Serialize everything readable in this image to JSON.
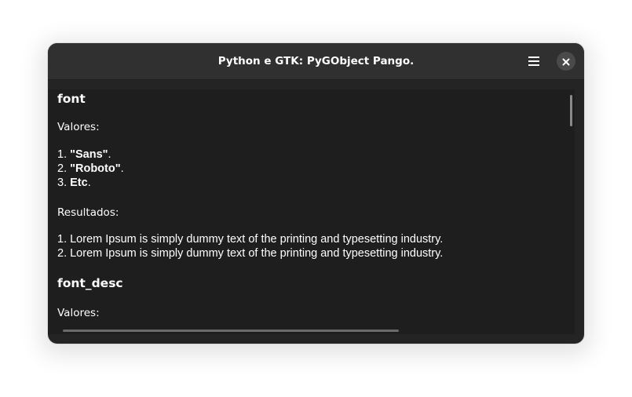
{
  "window": {
    "title": "Python e GTK: PyGObject Pango."
  },
  "header": {
    "menu_icon": "hamburger-menu-icon",
    "close_icon": "close-icon"
  },
  "sections": [
    {
      "heading": "font",
      "values_label": "Valores:",
      "values": [
        {
          "prefix": "1. ",
          "strong": "\"Sans\"",
          "suffix": "."
        },
        {
          "prefix": "2. ",
          "strong": "\"Roboto\"",
          "suffix": "."
        },
        {
          "prefix": "3. ",
          "strong": "Etc",
          "suffix": "."
        }
      ],
      "results_label": "Resultados:",
      "results": [
        "1. Lorem Ipsum is simply dummy text of the printing and typesetting industry.",
        "2. Lorem Ipsum is simply dummy text of the printing and typesetting industry."
      ]
    },
    {
      "heading": "font_desc",
      "values_label": "Valores:"
    }
  ],
  "colors": {
    "window_bg": "#242424",
    "headerbar_bg": "#303030",
    "content_bg": "#1e1e1e",
    "text": "#ffffff"
  }
}
